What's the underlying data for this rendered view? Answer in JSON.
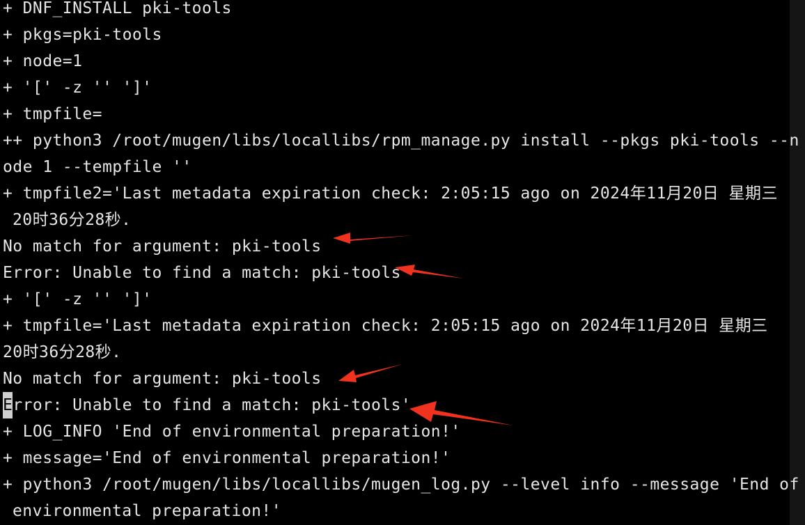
{
  "terminal": {
    "lines": [
      "+ DNF_INSTALL pki-tools",
      "+ pkgs=pki-tools",
      "+ node=1",
      "+ '[' -z '' ']'",
      "+ tmpfile=",
      "++ python3 /root/mugen/libs/locallibs/rpm_manage.py install --pkgs pki-tools --n",
      "ode 1 --tempfile ''",
      "+ tmpfile2='Last metadata expiration check: 2:05:15 ago on 2024年11月20日 星期三",
      "20时36分28秒.",
      "No match for argument: pki-tools",
      "Error: Unable to find a match: pki-tools'",
      "+ '[' -z '' ']'",
      "+ tmpfile='Last metadata expiration check: 2:05:15 ago on 2024年11月20日 星期三",
      "20时36分28秒.",
      "No match for argument: pki-tools",
      "rror: Unable to find a match: pki-tools'",
      "+ LOG_INFO 'End of environmental preparation!'",
      "+ message='End of environmental preparation!'",
      "+ python3 /root/mugen/libs/locallibs/mugen_log.py --level info --message 'End of",
      "environmental preparation!'"
    ],
    "cursor_char": "E"
  },
  "annotation_color": "#f0321e"
}
